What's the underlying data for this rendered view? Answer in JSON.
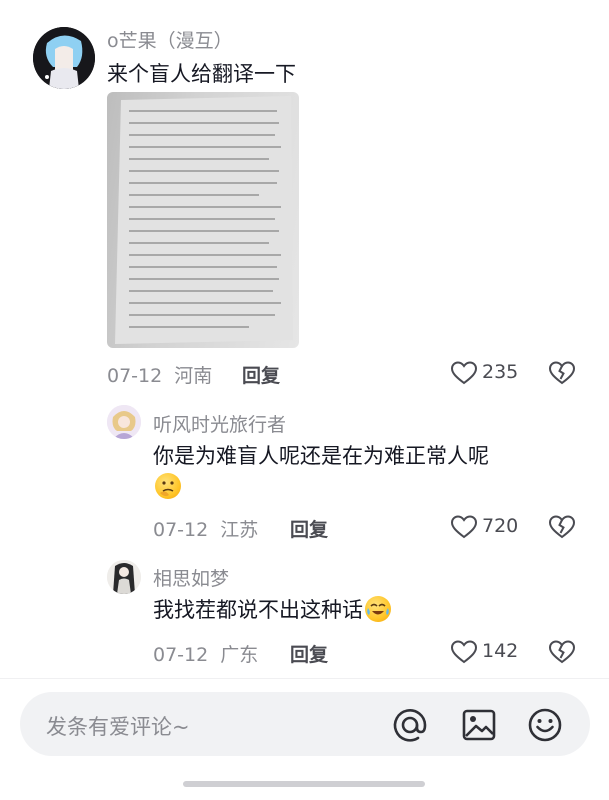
{
  "comments": [
    {
      "username": "o芒果（漫互）",
      "text": "来个盲人给翻译一下",
      "date": "07-12",
      "location": "河南",
      "reply_label": "回复",
      "likes": "235"
    },
    {
      "username": "听风时光旅行者",
      "text_line1": "你是为难盲人呢还是在为难正常人呢",
      "date": "07-12",
      "location": "江苏",
      "reply_label": "回复",
      "likes": "720"
    },
    {
      "username": "相思如梦",
      "text": "我找茬都说不出这种话",
      "date": "07-12",
      "location": "广东",
      "reply_label": "回复",
      "likes": "142"
    }
  ],
  "composer": {
    "placeholder": "发条有爱评论~"
  },
  "icons": {
    "like": "heart-outline-icon",
    "dislike": "broken-heart-icon",
    "mention": "at-icon",
    "image": "image-icon",
    "emoji": "smiley-icon"
  },
  "colors": {
    "muted_text": "#8a8b91",
    "body_text": "#161823",
    "bar_bg": "#f1f2f4"
  }
}
